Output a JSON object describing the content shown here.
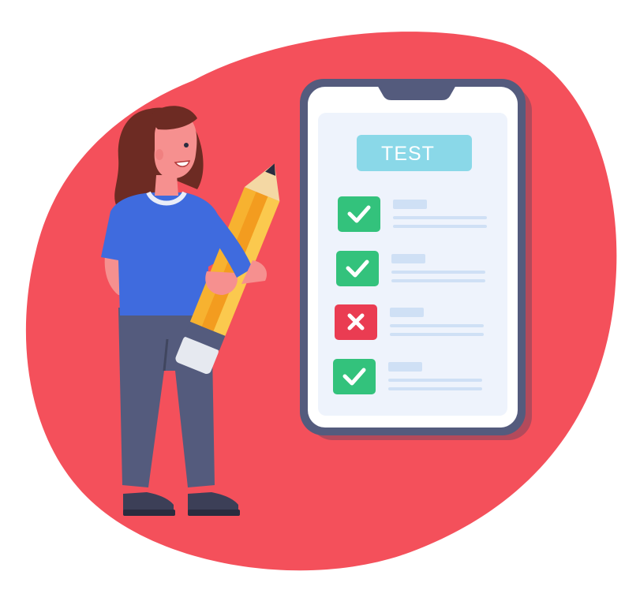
{
  "illustration": {
    "phone": {
      "header_label": "TEST",
      "checklist": [
        {
          "status": "pass",
          "icon": "check-icon"
        },
        {
          "status": "pass",
          "icon": "check-icon"
        },
        {
          "status": "fail",
          "icon": "cross-icon"
        },
        {
          "status": "pass",
          "icon": "check-icon"
        }
      ]
    },
    "colors": {
      "blob": "#f4505b",
      "phone_frame": "#545b7d",
      "screen": "#eef3fc",
      "header_chip": "#8ad8e8",
      "pass": "#33c27c",
      "fail": "#ea3c52",
      "placeholder_line": "#cfe0f5",
      "pencil_body": "#f7b230",
      "shirt": "#3f6bde",
      "pants": "#545b7d",
      "hair": "#6d2b23"
    }
  }
}
